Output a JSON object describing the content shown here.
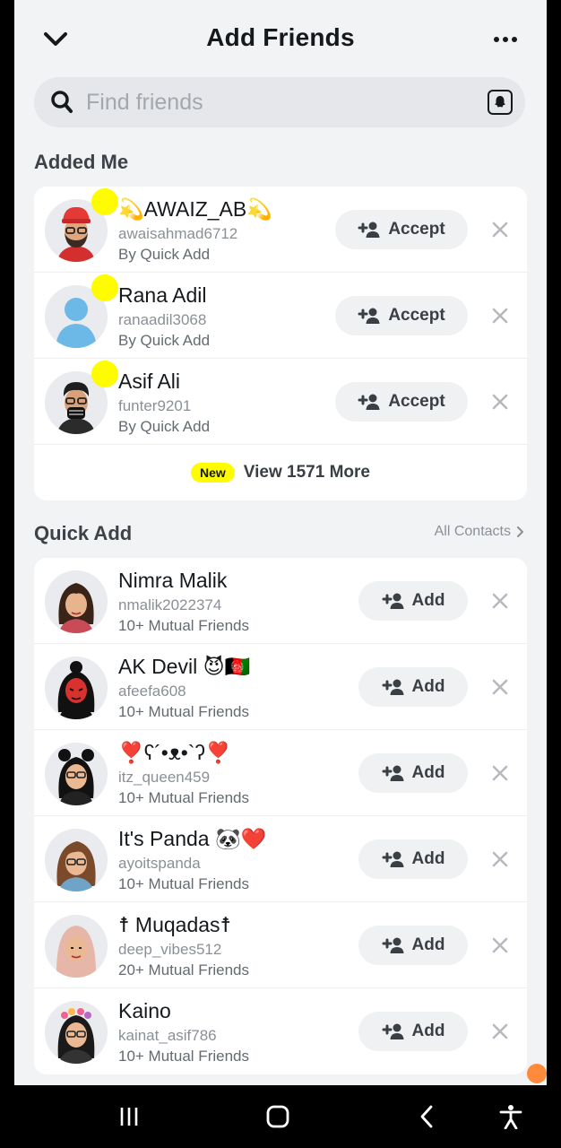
{
  "header": {
    "title": "Add Friends",
    "back_icon": "chevron-down-icon",
    "more_icon": "more-horizontal-icon"
  },
  "search": {
    "placeholder": "Find friends",
    "value": ""
  },
  "added_me": {
    "title": "Added Me",
    "accept_label": "Accept",
    "items": [
      {
        "name": "💫AWAIZ_AB💫",
        "username": "awaisahmad6712",
        "sub": "By Quick Add"
      },
      {
        "name": "Rana Adil",
        "username": "ranaadil3068",
        "sub": "By Quick Add"
      },
      {
        "name": "Asif Ali",
        "username": "funter9201",
        "sub": "By Quick Add"
      }
    ],
    "new_badge": "New",
    "view_more": "View 1571 More"
  },
  "quick_add": {
    "title": "Quick Add",
    "all_contacts": "All Contacts",
    "add_label": "Add",
    "items": [
      {
        "name": "Nimra Malik",
        "username": "nmalik2022374",
        "sub": "10+ Mutual Friends"
      },
      {
        "name": "AK Devil 😈🇦🇫",
        "username": "afeefa608",
        "sub": "10+ Mutual Friends"
      },
      {
        "name": "❣️ʕ´•ᴥ•`ʔ❣️",
        "username": "itz_queen459",
        "sub": "10+ Mutual Friends"
      },
      {
        "name": "It's Panda 🐼❤️",
        "username": "ayoitspanda",
        "sub": "10+ Mutual Friends"
      },
      {
        "name": "☨ Muqadas☨",
        "username": "deep_vibes512",
        "sub": "20+ Mutual Friends"
      },
      {
        "name": "Kaino",
        "username": "kainat_asif786",
        "sub": "10+ Mutual Friends"
      }
    ]
  },
  "colors": {
    "accent_yellow": "#fffc00",
    "background": "#f2f3f5",
    "card": "#ffffff"
  }
}
